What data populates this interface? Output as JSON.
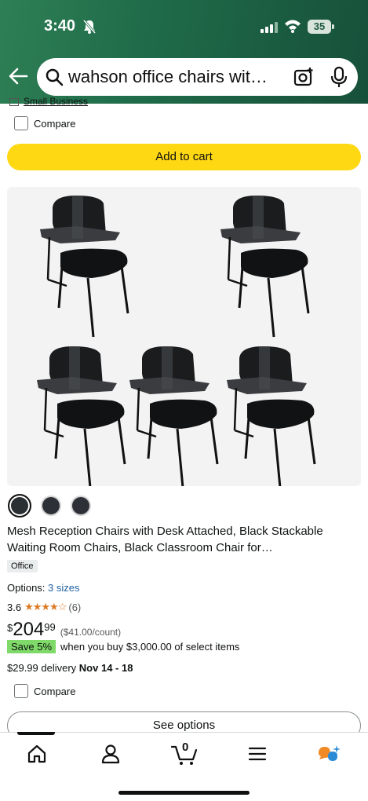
{
  "status_bar": {
    "time": "3:40",
    "battery": "35"
  },
  "search": {
    "query": "wahson office chairs wit…"
  },
  "previous_item": {
    "small_business_label": "Small Business",
    "compare_label": "Compare",
    "add_to_cart_label": "Add to cart"
  },
  "product": {
    "title": "Mesh Reception Chairs with Desk Attached, Black Stackable Waiting Room Chairs, Black Classroom Chair for Student/Office/Conference…",
    "badge": "Office",
    "options_label": "Options:",
    "options_link": "3 sizes",
    "rating_value": "3.6",
    "stars": "★★★★☆",
    "rating_count": "(6)",
    "price_symbol": "$",
    "price_whole": "204",
    "price_fraction": "99",
    "unit_price": "($41.00/count)",
    "save_tag": "Save 5%",
    "save_text": "when you buy $3,000.00 of select items",
    "delivery_price": "$29.99 delivery",
    "delivery_date": "Nov 14 - 18",
    "compare_label": "Compare",
    "see_options_label": "See options",
    "swatch_count": 3,
    "selected_swatch": 0
  },
  "colors": {
    "header": "#1f6b49",
    "add_to_cart": "#ffd814",
    "save_tag": "#7fda69",
    "link": "#2162a1",
    "stars": "#de7921"
  },
  "tabbar": {
    "cart_count": "0",
    "tabs": [
      "home-icon",
      "account-icon",
      "cart-icon",
      "menu-icon",
      "rufus-icon"
    ]
  }
}
